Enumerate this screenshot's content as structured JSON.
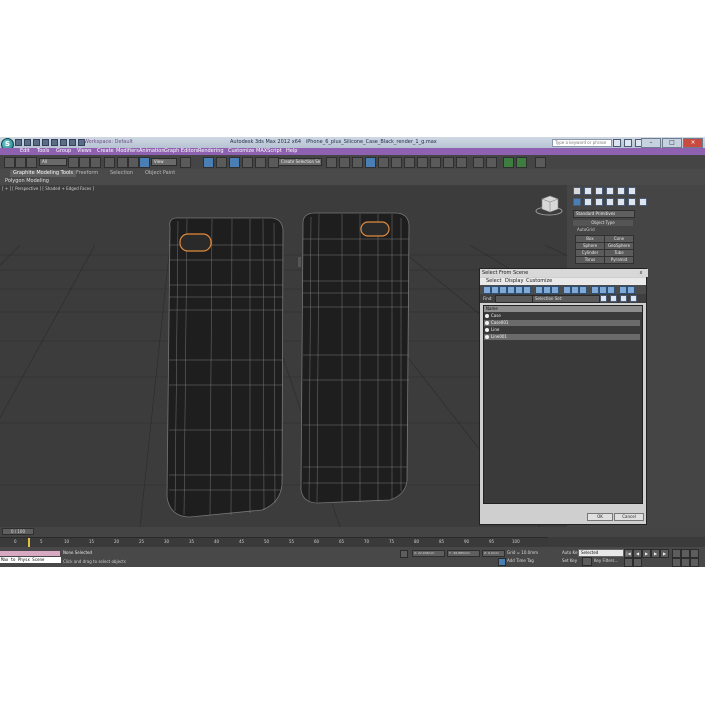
{
  "app": {
    "title": "Autodesk 3ds Max 2012 x64",
    "file_name": "iPhone_6_plus_Silicone_Case_Black_render_1_g.max",
    "workspace": "Workspace: Default",
    "search_placeholder": "Type a keyword or phrase",
    "logo_letter": "S"
  },
  "menu": [
    "Edit",
    "Tools",
    "Group",
    "Views",
    "Create",
    "Modifiers",
    "Animation",
    "Graph Editors",
    "Rendering",
    "Customize",
    "MAXScript",
    "Help"
  ],
  "toolbar": {
    "filter": "All",
    "refcoord": "View",
    "named_set": "Create Selection Se"
  },
  "ribbon": {
    "tabs": [
      "Graphite Modeling Tools",
      "Freeform",
      "Selection",
      "Object Paint"
    ],
    "active_tab": "Graphite Modeling Tools",
    "sub_label": "Polygon Modeling"
  },
  "viewport": {
    "label": "[ + ] [ Perspective ] [ Shaded + Edged Faces ]"
  },
  "command_panel": {
    "category": "Standard Primitives",
    "object_type_header": "Object Type",
    "autogrid": "AutoGrid",
    "primitives": [
      "Box",
      "Cone",
      "Sphere",
      "GeoSphere",
      "Cylinder",
      "Tube",
      "Torus",
      "Pyramid"
    ]
  },
  "dialog": {
    "title": "Select From Scene",
    "close_glyph": "x",
    "menu": [
      "Select",
      "Display",
      "Customize"
    ],
    "find_label": "Find:",
    "selection_set_label": "Selection Set:",
    "list_header": "Name",
    "items": [
      {
        "name": "Case",
        "selected": false
      },
      {
        "name": "Case001",
        "selected": true
      },
      {
        "name": "Line",
        "selected": false
      },
      {
        "name": "Line001",
        "selected": true
      }
    ],
    "ok": "OK",
    "cancel": "Cancel"
  },
  "timeline": {
    "slider": "0 / 100",
    "ticks": [
      "0",
      "5",
      "10",
      "15",
      "20",
      "25",
      "30",
      "35",
      "40",
      "45",
      "50",
      "55",
      "60",
      "65",
      "70",
      "75",
      "80",
      "85",
      "90",
      "95",
      "100"
    ]
  },
  "status": {
    "maxscript_text": "Max to Physx Scene",
    "selection": "None Selected",
    "prompt": "Click and drag to select objects",
    "x": "X: 22.934mm",
    "y": "Y: -56.885mm",
    "z": "Z: 0.0mm",
    "grid": "Grid = 10.0mm",
    "add_time_tag": "Add Time Tag",
    "auto_key": "Auto Key",
    "set_key": "Set Key",
    "selected": "Selected",
    "key_filters": "Key Filters..."
  },
  "colors": {
    "menu_bar": "#8e62b0",
    "viewport_bg": "#3c3c3c",
    "camera_hole": "#e08a3c",
    "maxscript_top": "#d8a9c2"
  }
}
